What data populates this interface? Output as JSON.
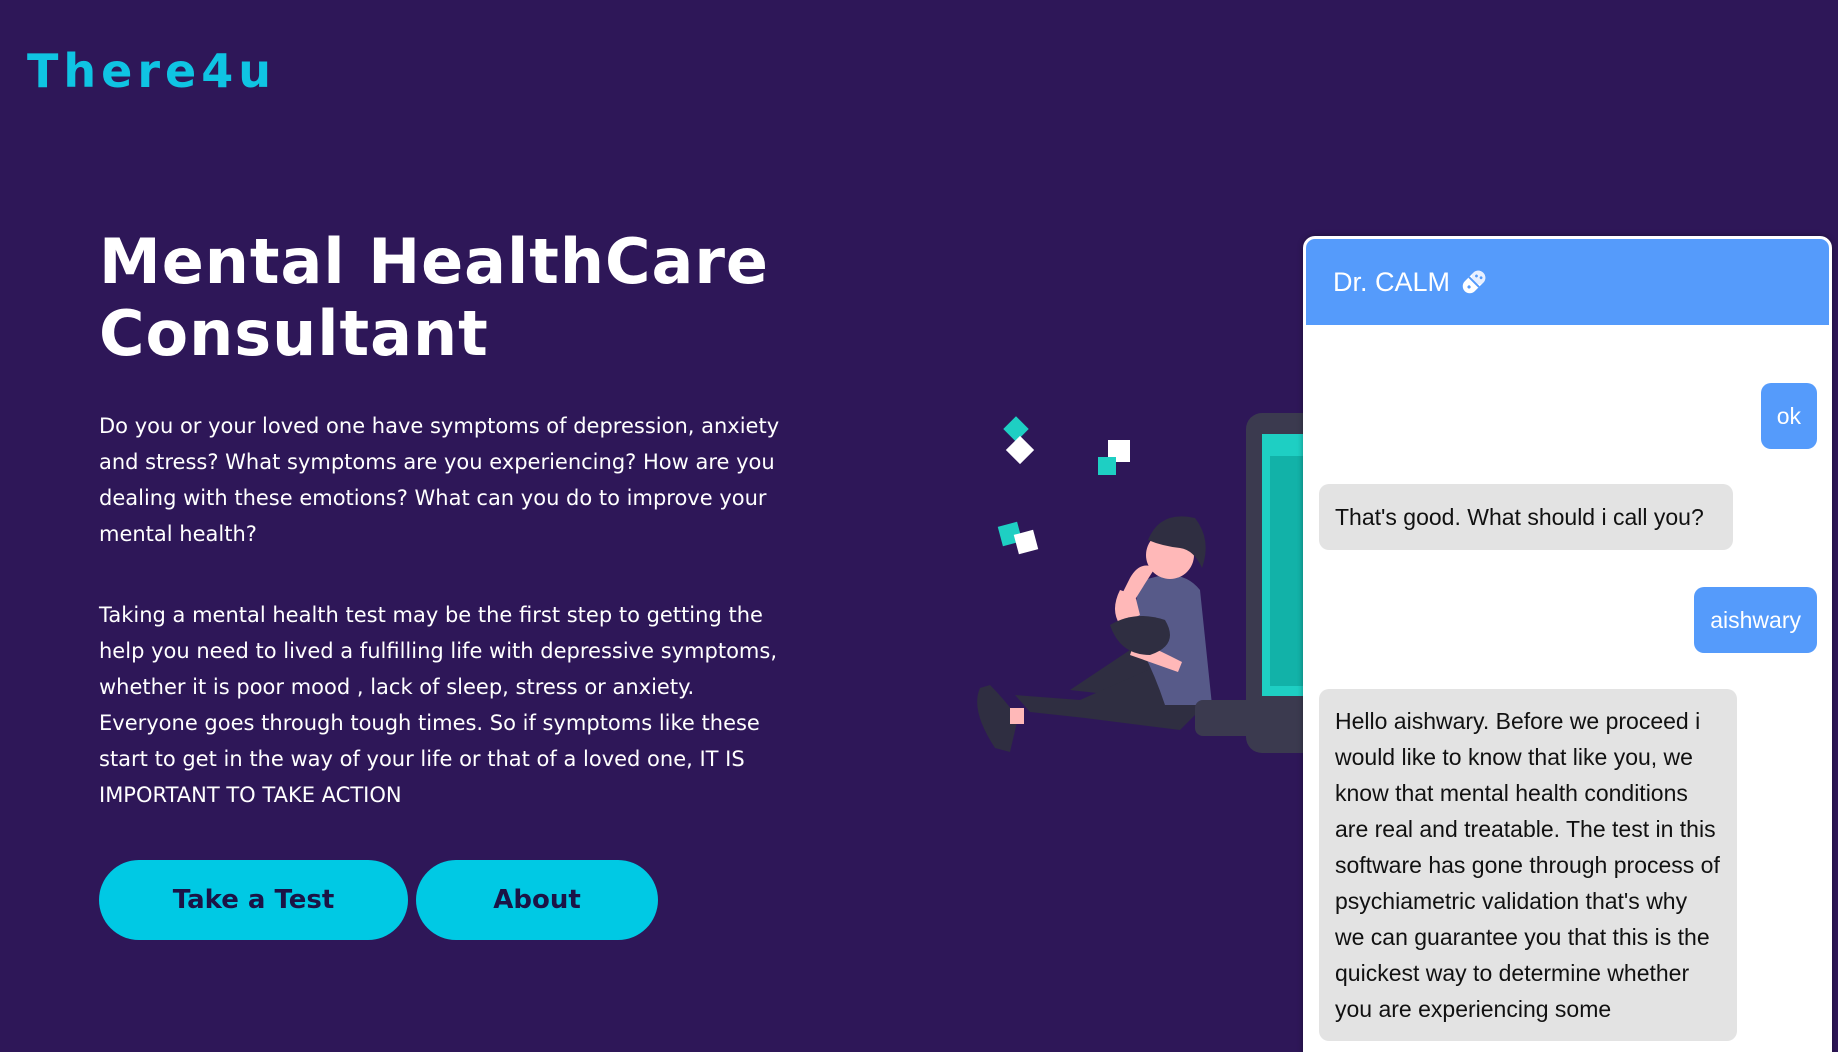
{
  "brand": {
    "logo": "There4u"
  },
  "hero": {
    "title": "Mental HealthCare Consultant",
    "paragraph1": "Do you or your loved one have symptoms of depression, anxiety and stress? What symptoms are you experiencing? How are you dealing with these emotions? What can you do to improve your mental health?",
    "paragraph2": "Taking a mental health test may be the first step to getting the help you need to lived a fulfilling life with depressive symptoms, whether it is poor mood , lack of sleep, stress or anxiety. Everyone goes through tough times. So if symptoms like these start to get in the way of your life or that of a loved one, IT IS IMPORTANT TO TAKE ACTION",
    "buttons": {
      "take_test": "Take a Test",
      "about": "About"
    }
  },
  "chat": {
    "title": "Dr. CALM",
    "title_icon": "pill-icon",
    "messages": [
      {
        "sender": "user",
        "text": "ok"
      },
      {
        "sender": "bot",
        "text": "That's good. What should i call you?"
      },
      {
        "sender": "user",
        "text": "aishwary"
      },
      {
        "sender": "bot",
        "text": "Hello aishwary. Before we proceed i would like to know that like you, we know that mental health conditions are real and treatable. The test in this software has gone through process of psychiametric validation that's why we can guarantee you that this is the quickest way to determine whether you are experiencing some"
      }
    ]
  },
  "colors": {
    "background": "#2e1758",
    "accent": "#00c9e4",
    "logo": "#0fc4e3",
    "chat_header": "#559bfb",
    "user_bubble": "#559bfb",
    "bot_bubble": "#e3e3e3"
  }
}
